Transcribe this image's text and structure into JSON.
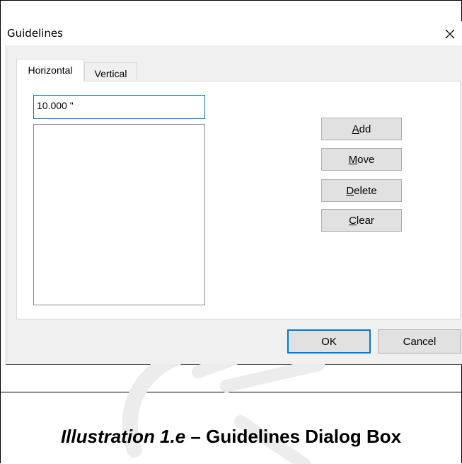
{
  "dialog": {
    "title": "Guidelines",
    "close_icon": "close-icon"
  },
  "tabs": [
    {
      "label": "Horizontal",
      "active": true
    },
    {
      "label": "Vertical",
      "active": false
    }
  ],
  "guide_input": {
    "value": "10.000 \""
  },
  "guide_list": {
    "items": []
  },
  "side_buttons": {
    "add": {
      "mnemonic": "A",
      "rest": "dd"
    },
    "move": {
      "mnemonic": "M",
      "rest": "ove"
    },
    "delete": {
      "mnemonic": "D",
      "rest": "elete"
    },
    "clear": {
      "mnemonic": "C",
      "rest": "lear"
    }
  },
  "footer_buttons": {
    "ok": "OK",
    "cancel": "Cancel"
  },
  "caption": {
    "label": "Illustration 1.e",
    "dash": " – ",
    "text": "Guidelines Dialog Box"
  },
  "colors": {
    "accent_focus": "#0078d7",
    "dialog_bg": "#f0f0f0",
    "button_bg": "#e1e1e1"
  }
}
